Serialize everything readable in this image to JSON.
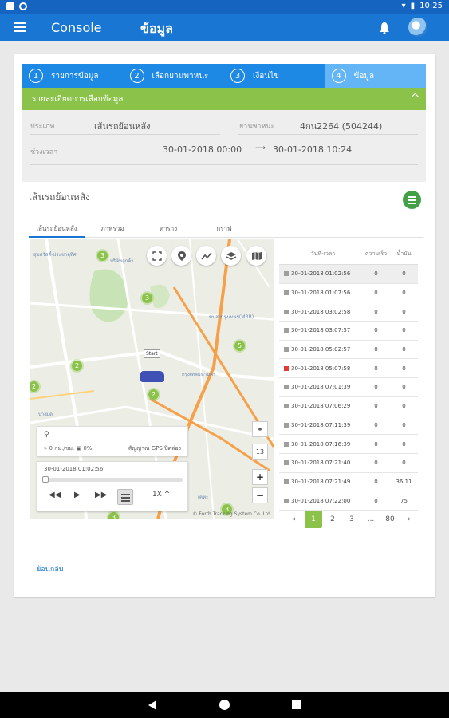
{
  "status_bar": {
    "time": "10:25"
  },
  "app_bar": {
    "title": "Console",
    "subtitle": "ข้อมูล"
  },
  "steps": [
    {
      "num": "1",
      "label": "รายการข้อมูล"
    },
    {
      "num": "2",
      "label": "เลือกยานพาหนะ"
    },
    {
      "num": "3",
      "label": "เงื่อนไข"
    },
    {
      "num": "4",
      "label": "ข้อมูล"
    }
  ],
  "detail": {
    "header": "รายละเอียดการเลือกข้อมูล",
    "vehicle_label": "ประเภท",
    "vehicle_value": "เส้นรถย้อนหลัง",
    "plate_label": "ยานพาหนะ",
    "plate_value": "4กน2264 (504244)",
    "period_label": "ช่วงเวลา",
    "start": "30-01-2018 00:00",
    "arrow": "⟶",
    "end": "30-01-2018 10:24"
  },
  "section_title": "เส้นรถย้อนหลัง",
  "tabs": [
    "เส้นรถย้อนหลัง",
    "ภาพรวม",
    "ตาราง",
    "กราฟ"
  ],
  "map": {
    "start_label": "Start",
    "clusters": [
      "3",
      "2",
      "2",
      "5",
      "2",
      "3",
      "3",
      "3"
    ],
    "labels": [
      "สุขสวัสดิ์-ประชาอุทิศ",
      "บริษัทลูกค้า",
      "ขนส่งกรุงเทพฯ(MRB)",
      "กรุงเทพมหานคร",
      "บางมด",
      "เคหะ"
    ],
    "copyright": "© Forth Tracking System Co.,Ltd",
    "zoom_level": "13",
    "info_speed": "0 กม./ชม.",
    "info_fuel": "0%",
    "info_gps": "สัญญาณ GPS ปิดล่อง",
    "player_date": "30-01-2018 01:02:56",
    "player_speed": "1X"
  },
  "table": {
    "headers": [
      "วันที่-เวลา",
      "ความเร็ว",
      "น้ำมัน"
    ],
    "rows": [
      {
        "time": "30-01-2018 01:02:56",
        "speed": "0",
        "fuel": "0",
        "flag": "normal"
      },
      {
        "time": "30-01-2018 01:07:56",
        "speed": "0",
        "fuel": "0",
        "flag": "normal"
      },
      {
        "time": "30-01-2018 03:02:58",
        "speed": "0",
        "fuel": "0",
        "flag": "normal"
      },
      {
        "time": "30-01-2018 03:07:57",
        "speed": "0",
        "fuel": "0",
        "flag": "normal"
      },
      {
        "time": "30-01-2018 05:02:57",
        "speed": "0",
        "fuel": "0",
        "flag": "normal"
      },
      {
        "time": "30-01-2018 05:07:58",
        "speed": "0",
        "fuel": "0",
        "flag": "alert"
      },
      {
        "time": "30-01-2018 07:01:39",
        "speed": "0",
        "fuel": "0",
        "flag": "normal"
      },
      {
        "time": "30-01-2018 07:06:29",
        "speed": "0",
        "fuel": "0",
        "flag": "normal"
      },
      {
        "time": "30-01-2018 07:11:39",
        "speed": "0",
        "fuel": "0",
        "flag": "normal"
      },
      {
        "time": "30-01-2018 07:16:39",
        "speed": "0",
        "fuel": "0",
        "flag": "normal"
      },
      {
        "time": "30-01-2018 07:21:40",
        "speed": "0",
        "fuel": "0",
        "flag": "normal"
      },
      {
        "time": "30-01-2018 07:21:49",
        "speed": "0",
        "fuel": "36.11",
        "flag": "normal"
      },
      {
        "time": "30-01-2018 07:22:00",
        "speed": "0",
        "fuel": "75",
        "flag": "normal"
      }
    ]
  },
  "pager": {
    "prev": "‹",
    "pages": [
      "1",
      "2",
      "3"
    ],
    "ellipsis": "...",
    "last": "80",
    "next": "›",
    "active": "1"
  },
  "back_link": "ย้อนกลับ",
  "colors": {
    "primary": "#1976d2",
    "accent": "#8bc34a",
    "status": "#1565c0"
  }
}
